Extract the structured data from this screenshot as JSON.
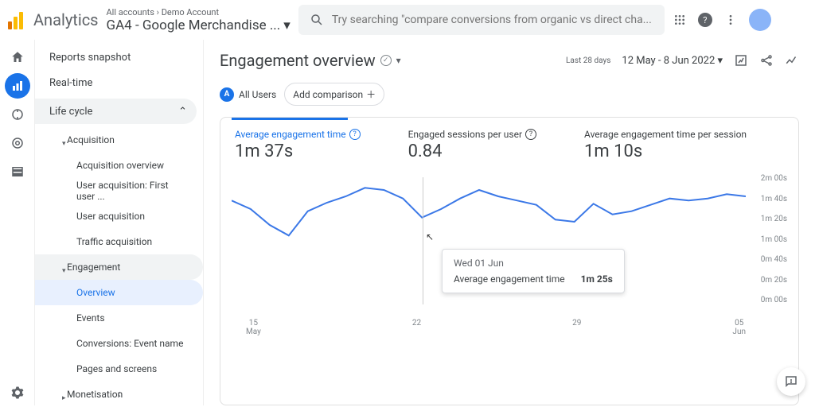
{
  "brand": "Analytics",
  "breadcrumb": "All accounts › Demo Account",
  "property": "GA4 - Google Merchandise ...",
  "search": {
    "placeholder": "Try searching \"compare conversions from organic vs direct cha..."
  },
  "nav": {
    "snapshot": "Reports snapshot",
    "realtime": "Real-time",
    "section": "Life cycle",
    "acquisition": "Acquisition",
    "acq_items": [
      "Acquisition overview",
      "User acquisition: First user ...",
      "User acquisition",
      "Traffic acquisition"
    ],
    "engagement": "Engagement",
    "eng_items": [
      "Overview",
      "Events",
      "Conversions: Event name",
      "Pages and screens"
    ],
    "monetisation": "Monetisation"
  },
  "page": {
    "title": "Engagement overview",
    "date_label": "Last 28 days",
    "date_range": "12 May - 8 Jun 2022",
    "all_users": "All Users",
    "add_comparison": "Add comparison"
  },
  "metrics": [
    {
      "label": "Average engagement time",
      "value": "1m 37s"
    },
    {
      "label": "Engaged sessions per user",
      "value": "0.84"
    },
    {
      "label": "Average engagement time per session",
      "value": "1m 10s"
    }
  ],
  "tooltip": {
    "date": "Wed 01 Jun",
    "metric": "Average engagement time",
    "value": "1m 25s"
  },
  "chart_data": {
    "type": "line",
    "title": "Average engagement time",
    "xlabel": "",
    "ylabel": "",
    "ylim_seconds": [
      0,
      120
    ],
    "y_ticks": [
      "2m 00s",
      "1m 40s",
      "1m 20s",
      "1m 00s",
      "0m 40s",
      "0m 20s",
      "0m 00s"
    ],
    "x_ticks": [
      {
        "top": "15",
        "bot": "May"
      },
      {
        "top": "22",
        "bot": ""
      },
      {
        "top": "29",
        "bot": ""
      },
      {
        "top": "05",
        "bot": "Jun"
      }
    ],
    "x": [
      "12 May",
      "13 May",
      "14 May",
      "15 May",
      "16 May",
      "17 May",
      "18 May",
      "19 May",
      "20 May",
      "21 May",
      "22 May",
      "23 May",
      "24 May",
      "25 May",
      "26 May",
      "27 May",
      "28 May",
      "29 May",
      "30 May",
      "31 May",
      "01 Jun",
      "02 Jun",
      "03 Jun",
      "04 Jun",
      "05 Jun",
      "06 Jun",
      "07 Jun",
      "08 Jun"
    ],
    "values_seconds": [
      98,
      90,
      75,
      65,
      88,
      96,
      102,
      110,
      108,
      100,
      82,
      90,
      100,
      108,
      102,
      98,
      94,
      80,
      78,
      95,
      85,
      88,
      94,
      100,
      98,
      100,
      104,
      102
    ]
  }
}
